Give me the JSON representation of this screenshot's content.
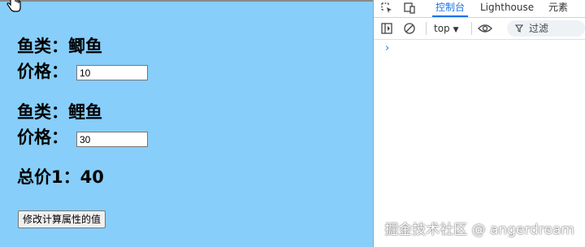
{
  "page": {
    "fish1": {
      "label": "鱼类：鲫鱼",
      "price_label": "价格：",
      "price_value": "10"
    },
    "fish2": {
      "label": "鱼类：鲤鱼",
      "price_label": "价格：",
      "price_value": "30"
    },
    "total": "总价1：40",
    "button_label": "修改计算属性的值"
  },
  "devtools": {
    "tabs": [
      "控制台",
      "Lighthouse",
      "元素"
    ],
    "active_tab": "控制台",
    "context": "top",
    "filter_placeholder": "过滤",
    "prompt_symbol": "›"
  },
  "watermark": "掘金技术社区 @ angerdream",
  "colors": {
    "page_bg": "#87cefa",
    "accent": "#1a73e8"
  }
}
